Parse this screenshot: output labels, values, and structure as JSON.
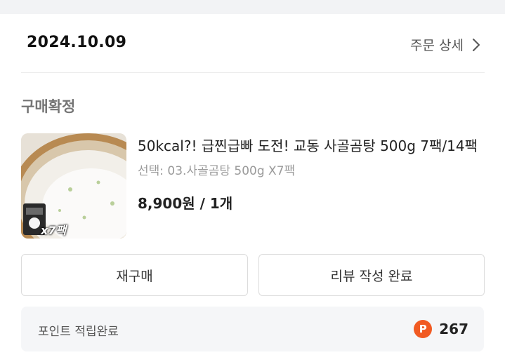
{
  "order": {
    "date": "2024.10.09",
    "detail_label": "주문 상세"
  },
  "status": "구매확정",
  "product": {
    "name": "50kcal?! 급찐급빠 도전! 교동 사골곰탕 500g 7팩/14팩",
    "option": "선택: 03.사골곰탕 500g X7팩",
    "price": "8,900원 / 1개",
    "thumbnail_badge": "x7팩"
  },
  "actions": {
    "rebuy_label": "재구매",
    "review_label": "리뷰 작성 완료"
  },
  "points": {
    "label": "포인트 적립완료",
    "icon_letter": "P",
    "value": "267",
    "icon_color": "#f15a22"
  }
}
